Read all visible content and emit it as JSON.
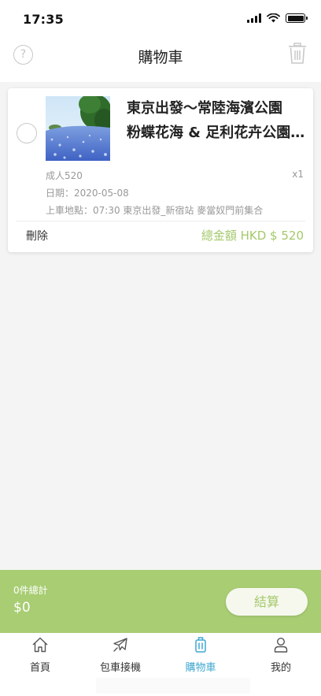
{
  "status_bar": {
    "time": "17:35"
  },
  "header": {
    "title": "購物車",
    "help_icon": "question-circle-icon",
    "trash_icon": "trash-can-icon"
  },
  "cart_item": {
    "title_line1": "東京出發～常陸海濱公園",
    "title_line2": "粉蝶花海 & 足利花卉公園 紫藤花",
    "ticket": "成人520",
    "quantity": "x1",
    "date": "日期：2020-05-08",
    "pickup": "上車地點：07:30 東京出發_新宿站 麥當奴門前集合",
    "delete_label": "刪除",
    "total_label": "總金額 HKD $ 520"
  },
  "checkout": {
    "count_label": "0件總計",
    "sum": "$0",
    "button_label": "結算"
  },
  "tabs": [
    {
      "label": "首頁",
      "icon": "home-icon",
      "active": false
    },
    {
      "label": "包車接機",
      "icon": "airplane-icon",
      "active": false
    },
    {
      "label": "購物車",
      "icon": "luggage-icon",
      "active": true
    },
    {
      "label": "我的",
      "icon": "user-icon",
      "active": false
    }
  ],
  "colors": {
    "accent_green": "#a8cd73",
    "active_tab_blue": "#3fa7d1"
  }
}
